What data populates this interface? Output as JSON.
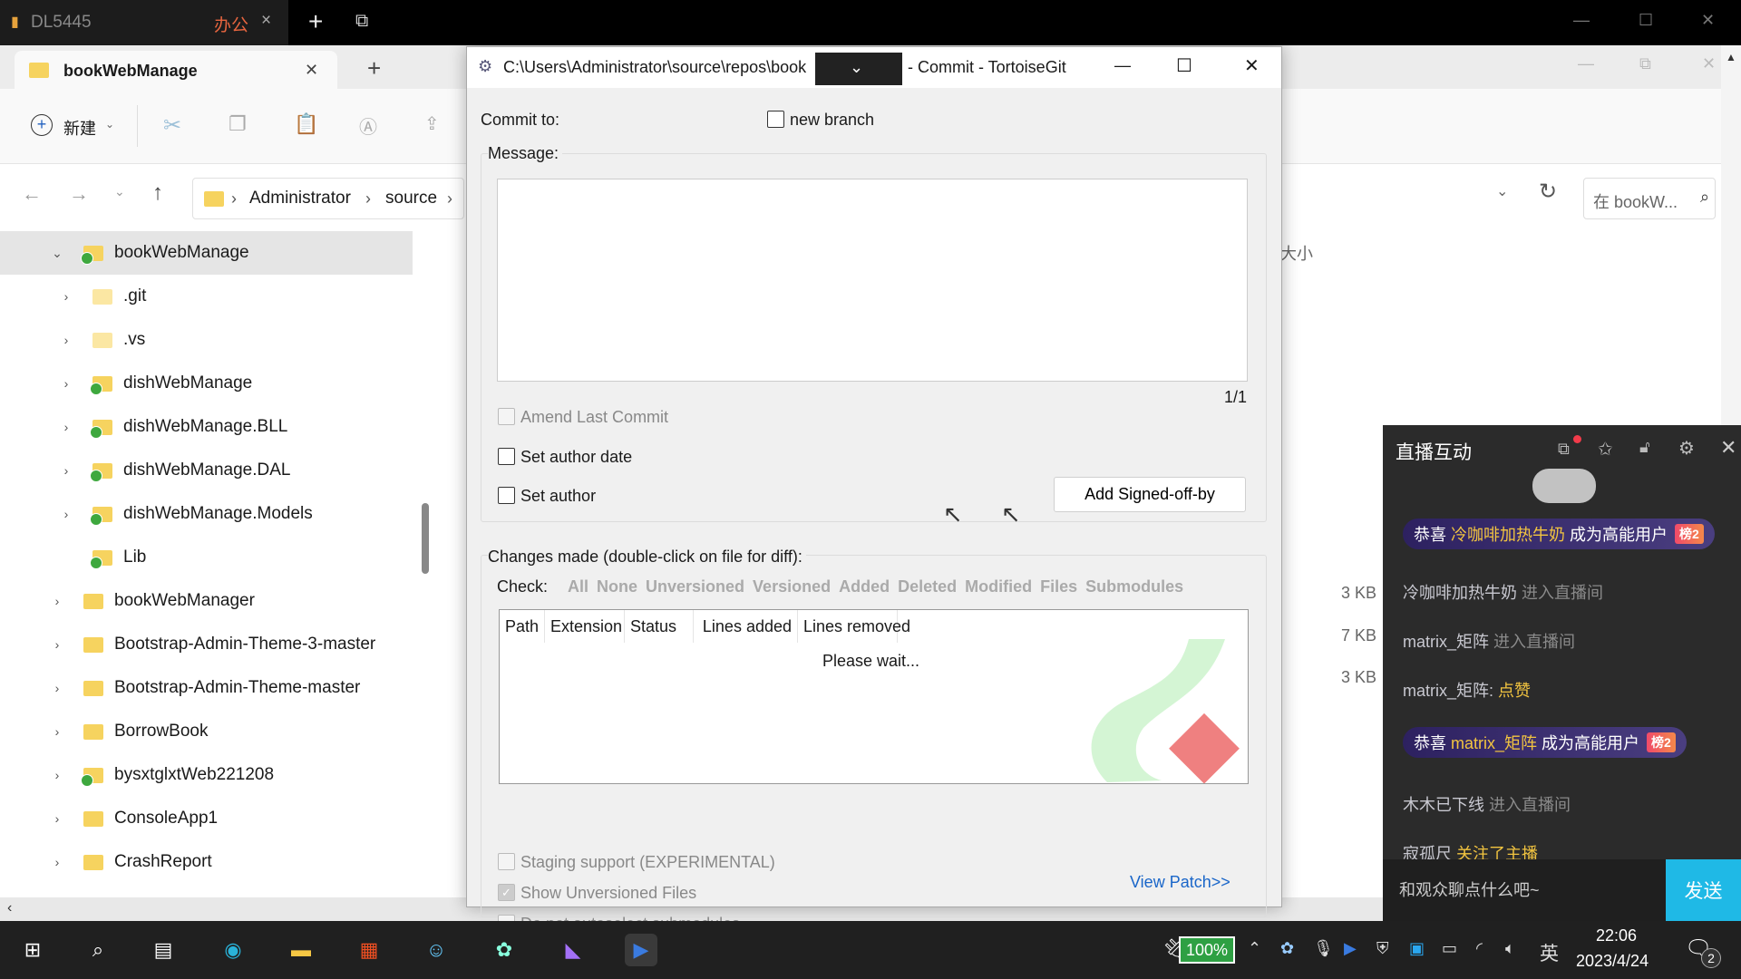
{
  "top_bar": {
    "app_label": "DL5445",
    "tag": "办公",
    "close": "×",
    "new_tab": "+",
    "restore": "⧉",
    "minimize": "—",
    "maximize": "☐",
    "close_window": "✕"
  },
  "explorer": {
    "tab_title": "bookWebManage",
    "tab_close": "✕",
    "new_tab": "+",
    "toolbar": {
      "new_label": "新建"
    },
    "breadcrumb": [
      "Administrator",
      "source"
    ],
    "search_placeholder": "在 bookW...",
    "column_header_partial": "大小",
    "sizes": [
      "3 KB",
      "7 KB",
      "3 KB"
    ],
    "tree": [
      {
        "label": "bookWebManage",
        "level": 1,
        "expanded": true,
        "git": true,
        "selected": true
      },
      {
        "label": ".git",
        "level": 2,
        "git": false,
        "pale": true
      },
      {
        "label": ".vs",
        "level": 2,
        "git": false,
        "pale": true
      },
      {
        "label": "dishWebManage",
        "level": 2,
        "git": true
      },
      {
        "label": "dishWebManage.BLL",
        "level": 2,
        "git": true
      },
      {
        "label": "dishWebManage.DAL",
        "level": 2,
        "git": true
      },
      {
        "label": "dishWebManage.Models",
        "level": 2,
        "git": true
      },
      {
        "label": "Lib",
        "level": 2,
        "git": true,
        "nochev": true
      },
      {
        "label": "bookWebManager",
        "level": 1,
        "git": false
      },
      {
        "label": "Bootstrap-Admin-Theme-3-master",
        "level": 1,
        "git": false
      },
      {
        "label": "Bootstrap-Admin-Theme-master",
        "level": 1,
        "git": false
      },
      {
        "label": "BorrowBook",
        "level": 1,
        "git": false
      },
      {
        "label": "bysxtglxtWeb221208",
        "level": 1,
        "git": true
      },
      {
        "label": "ConsoleApp1",
        "level": 1,
        "git": false
      },
      {
        "label": "CrashReport",
        "level": 1,
        "git": false
      }
    ]
  },
  "dialog": {
    "title_path": "C:\\Users\\Administrator\\source\\repos\\book",
    "title_suffix": "- Commit - TortoiseGit",
    "commit_to_label": "Commit to:",
    "new_branch_label": "new branch",
    "new_branch_checked": false,
    "message_label": "Message:",
    "message_value": "",
    "line_counter": "1/1",
    "amend_label": "Amend Last Commit",
    "set_author_date_label": "Set author date",
    "set_author_label": "Set author",
    "signed_off_button": "Add Signed-off-by",
    "changes_label": "Changes made (double-click on file for diff):",
    "check_label": "Check:",
    "check_filters": [
      "All",
      "None",
      "Unversioned",
      "Versioned",
      "Added",
      "Deleted",
      "Modified",
      "Files",
      "Submodules"
    ],
    "columns": [
      "Path",
      "Extension",
      "Status",
      "Lines added",
      "Lines removed"
    ],
    "please_wait": "Please wait...",
    "staging_label": "Staging support (EXPERIMENTAL)",
    "show_unversioned_label": "Show Unversioned Files",
    "show_unversioned_checked": true,
    "no_autoselect_label": "Do not autoselect submodules",
    "view_patch": "View Patch>>"
  },
  "chat": {
    "title": "直播互动",
    "messages": [
      {
        "type": "banner",
        "prefix": "恭喜",
        "user": "冷咖啡加热牛奶",
        "suffix": "成为高能用户",
        "badge": "榜2"
      },
      {
        "type": "text",
        "user": "冷咖啡加热牛奶",
        "action": "进入直播间",
        "action_color": "grey"
      },
      {
        "type": "text",
        "user": "matrix_矩阵",
        "action": "进入直播间",
        "action_color": "grey"
      },
      {
        "type": "text",
        "user": "matrix_矩阵:",
        "action": "点赞",
        "action_color": "gold"
      },
      {
        "type": "banner",
        "prefix": "恭喜",
        "user": "matrix_矩阵",
        "suffix": "成为高能用户",
        "badge": "榜2"
      },
      {
        "type": "text",
        "user": "木木已下线",
        "action": "进入直播间",
        "action_color": "grey"
      },
      {
        "type": "text",
        "user": "寂孤尺",
        "action": "关注了主播",
        "action_color": "gold"
      }
    ],
    "input_placeholder": "和观众聊点什么吧~",
    "send_label": "发送"
  },
  "taskbar": {
    "apps": [
      "start-icon",
      "search-icon",
      "task-view-icon",
      "edge-icon",
      "file-explorer-icon",
      "store-icon",
      "app-icon",
      "pinwheel-icon",
      "visual-studio-icon",
      "stream-app-icon"
    ],
    "battery": "100%",
    "ime": "英",
    "time": "22:06",
    "date": "2023/4/24",
    "notifications": "2"
  },
  "colors": {
    "accent": "#1fb9e6",
    "gold": "#f2c440",
    "battery": "#2ea043"
  }
}
